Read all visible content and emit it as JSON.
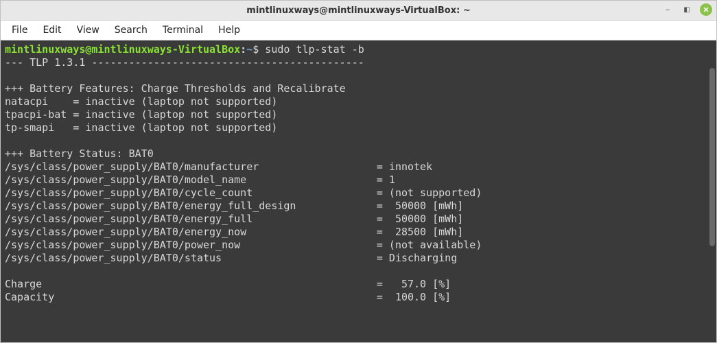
{
  "window": {
    "title": "mintlinuxways@mintlinuxways-VirtualBox: ~"
  },
  "menu": {
    "items": [
      "File",
      "Edit",
      "View",
      "Search",
      "Terminal",
      "Help"
    ]
  },
  "prompt": {
    "user_host": "mintlinuxways@mintlinuxways-VirtualBox",
    "colon": ":",
    "path": "~",
    "symbol": "$",
    "command": "sudo tlp-stat -b"
  },
  "output": {
    "header_line": "--- TLP 1.3.1 --------------------------------------------",
    "blank1": "",
    "features_header": "+++ Battery Features: Charge Thresholds and Recalibrate",
    "feat_natacpi": "natacpi    = inactive (laptop not supported)",
    "feat_tpacpi": "tpacpi-bat = inactive (laptop not supported)",
    "feat_tpsmapi": "tp-smapi   = inactive (laptop not supported)",
    "blank2": "",
    "status_header": "+++ Battery Status: BAT0",
    "s1": "/sys/class/power_supply/BAT0/manufacturer                   = innotek",
    "s2": "/sys/class/power_supply/BAT0/model_name                     = 1",
    "s3": "/sys/class/power_supply/BAT0/cycle_count                    = (not supported)",
    "s4": "/sys/class/power_supply/BAT0/energy_full_design             =  50000 [mWh]",
    "s5": "/sys/class/power_supply/BAT0/energy_full                    =  50000 [mWh]",
    "s6": "/sys/class/power_supply/BAT0/energy_now                     =  28500 [mWh]",
    "s7": "/sys/class/power_supply/BAT0/power_now                      = (not available)",
    "s8": "/sys/class/power_supply/BAT0/status                         = Discharging",
    "blank3": "",
    "charge": "Charge                                                      =   57.0 [%]",
    "capacity": "Capacity                                                    =  100.0 [%]"
  }
}
